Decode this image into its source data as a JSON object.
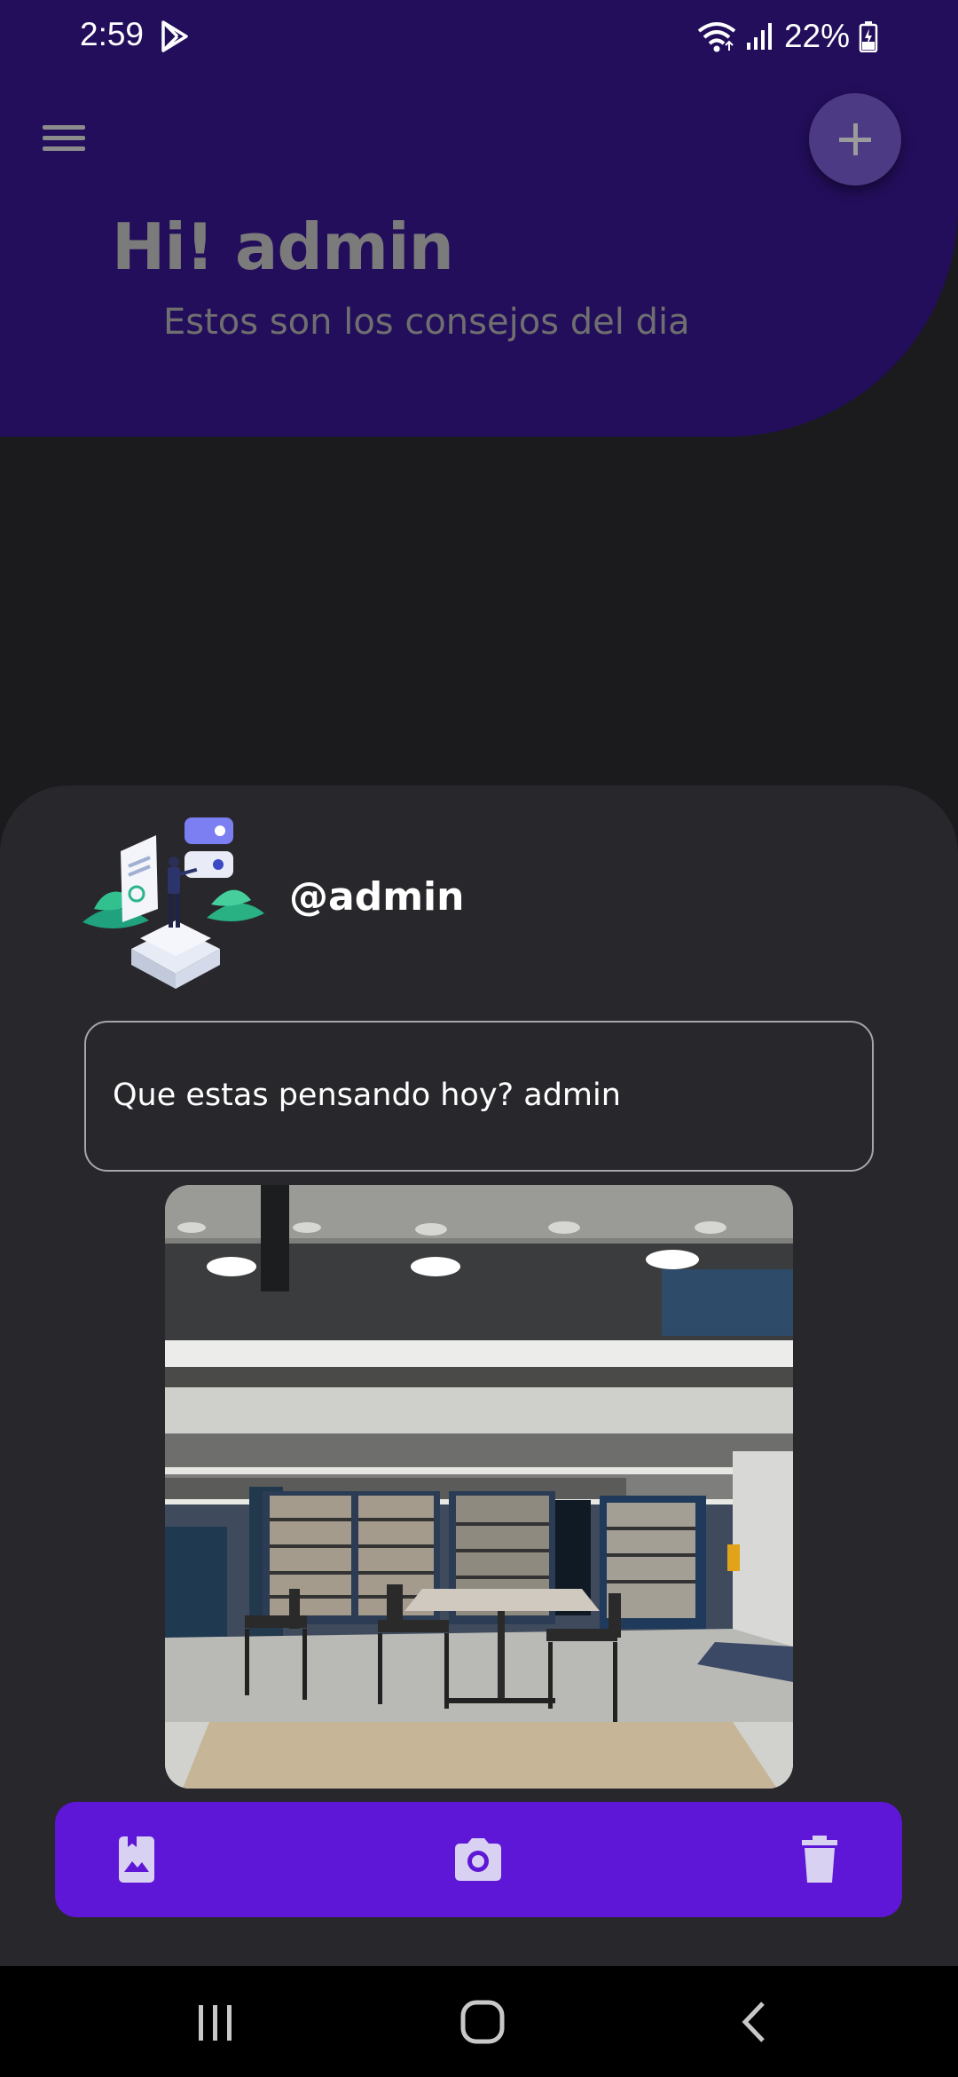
{
  "status_bar": {
    "time": "2:59",
    "battery": "22%",
    "icons": [
      "play-store-icon",
      "wifi-icon",
      "signal-icon",
      "battery-charging-icon"
    ]
  },
  "header": {
    "greeting": "Hi! admin",
    "subtitle": "Estos son los consejos del dia",
    "menu_icon": "menu-icon",
    "add_icon": "plus-icon",
    "background_color": "#230e5b"
  },
  "composer": {
    "username": "@admin",
    "input_value": "Que estas pensando hoy? admin",
    "actions": [
      {
        "icon": "image-bookmark-icon",
        "name": "gallery"
      },
      {
        "icon": "camera-icon",
        "name": "camera"
      },
      {
        "icon": "trash-icon",
        "name": "delete"
      }
    ],
    "action_bar_color": "#5e17d6"
  },
  "nav_bar": {
    "buttons": [
      "recent-apps-icon",
      "home-icon",
      "back-icon"
    ]
  }
}
